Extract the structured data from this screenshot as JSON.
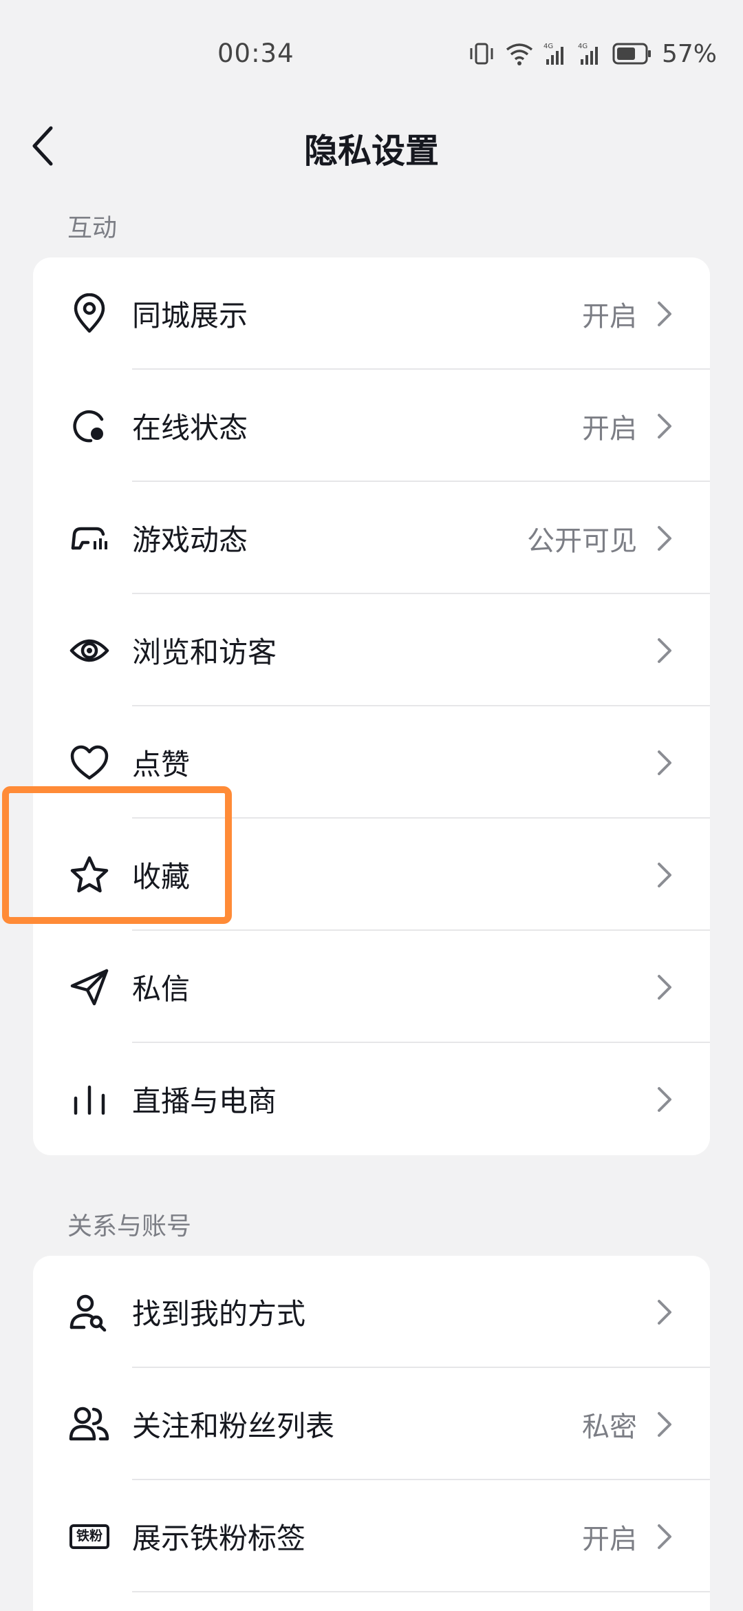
{
  "status_bar": {
    "time": "00:34",
    "battery_percent": "57%",
    "network_a": "4G",
    "network_b": "4G"
  },
  "header": {
    "title": "隐私设置",
    "back_icon": "chevron-left-icon"
  },
  "sections": [
    {
      "title": "互动",
      "items": [
        {
          "icon": "location-pin-icon",
          "label": "同城展示",
          "value": "开启"
        },
        {
          "icon": "online-status-icon",
          "label": "在线状态",
          "value": "开启"
        },
        {
          "icon": "gamepad-icon",
          "label": "游戏动态",
          "value": "公开可见"
        },
        {
          "icon": "eye-icon",
          "label": "浏览和访客",
          "value": ""
        },
        {
          "icon": "heart-icon",
          "label": "点赞",
          "value": ""
        },
        {
          "icon": "star-icon",
          "label": "收藏",
          "value": ""
        },
        {
          "icon": "send-icon",
          "label": "私信",
          "value": ""
        },
        {
          "icon": "live-bars-icon",
          "label": "直播与电商",
          "value": ""
        }
      ]
    },
    {
      "title": "关系与账号",
      "items": [
        {
          "icon": "user-search-icon",
          "label": "找到我的方式",
          "value": ""
        },
        {
          "icon": "users-icon",
          "label": "关注和粉丝列表",
          "value": "私密"
        },
        {
          "icon": "fan-badge-icon",
          "label": "展示铁粉标签",
          "value": "开启",
          "badge_text": "铁粉"
        }
      ]
    }
  ],
  "colors": {
    "highlight": "#ff8b37",
    "background": "#f2f2f3",
    "card": "#ffffff"
  }
}
